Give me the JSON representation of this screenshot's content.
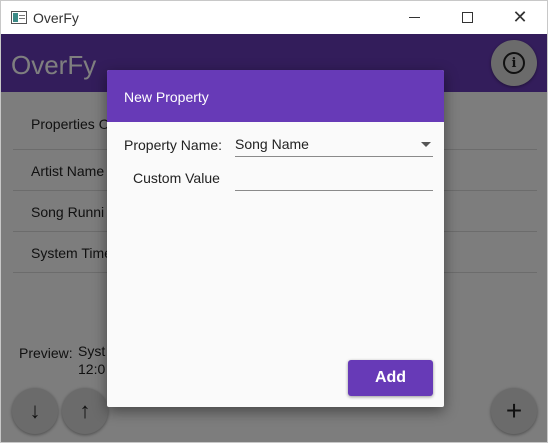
{
  "window": {
    "title": "OverFy"
  },
  "header": {
    "title": "OverFy"
  },
  "list": {
    "header": "Properties O",
    "items": [
      {
        "label": "Artist Name"
      },
      {
        "label": "Song Runni"
      },
      {
        "label": "System Time"
      }
    ]
  },
  "preview": {
    "label": "Preview:",
    "value_line1": "Syst",
    "value_line2": "12:0"
  },
  "dialog": {
    "title": "New Property",
    "property_name_label": "Property Name:",
    "property_name_value": "Song Name",
    "custom_value_label": "Custom Value",
    "custom_value": "",
    "add_label": "Add"
  },
  "icons": {
    "info": "info-icon",
    "down": "arrow-down-icon",
    "up": "arrow-up-icon",
    "add": "plus-icon"
  },
  "colors": {
    "accent": "#673ab7"
  }
}
